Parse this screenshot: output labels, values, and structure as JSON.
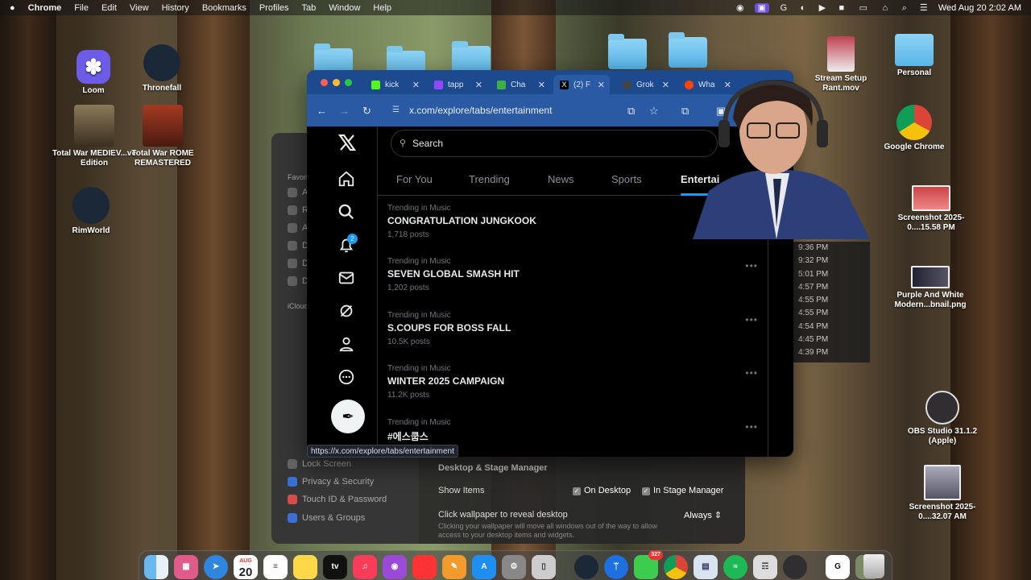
{
  "menubar": {
    "apple": "",
    "app": "Chrome",
    "items": [
      "File",
      "Edit",
      "View",
      "History",
      "Bookmarks",
      "Profiles",
      "Tab",
      "Window",
      "Help"
    ],
    "datetime": "Wed Aug 20  2:02 AM"
  },
  "desktop_icons": {
    "loom": "Loom",
    "thronefall": "Thronefall",
    "medieval": "Total War MEDIEV...ve Edition",
    "rome": "Total War ROME REMASTERED",
    "rimworld": "RimWorld",
    "stream": "Stream Setup Rant.mov",
    "personal": "Personal",
    "chrome": "Google Chrome",
    "shot1": "Screenshot 2025-0....15.58 PM",
    "purple": "Purple And White Modern...bnail.png",
    "obs": "OBS Studio 31.1.2 (Apple)",
    "shot2": "Screenshot 2025-0....32.07 AM"
  },
  "browser": {
    "tabs": [
      {
        "label": "kick",
        "color": "#53fc18"
      },
      {
        "label": "tapp",
        "color": "#9146ff"
      },
      {
        "label": "Cha",
        "color": "#3cb043"
      },
      {
        "label": "(2) F",
        "color": "#000000"
      },
      {
        "label": "Grok",
        "color": "#444444"
      },
      {
        "label": "Wha",
        "color": "#ff4500"
      }
    ],
    "url": "x.com/explore/tabs/entertainment",
    "status_url": "https://x.com/explore/tabs/entertainment"
  },
  "x": {
    "notif_count": "2",
    "search_placeholder": "Search",
    "tabs": [
      "For You",
      "Trending",
      "News",
      "Sports",
      "Entertai"
    ],
    "trends": [
      {
        "category": "Trending in Music",
        "title": "CONGRATULATION JUNGKOOK",
        "count": "1,718 posts"
      },
      {
        "category": "Trending in Music",
        "title": "SEVEN GLOBAL SMASH HIT",
        "count": "1,202 posts"
      },
      {
        "category": "Trending in Music",
        "title": "S.COUPS FOR BOSS FALL",
        "count": "10.5K posts"
      },
      {
        "category": "Trending in Music",
        "title": "WINTER 2025 CAMPAIGN",
        "count": "11.2K posts"
      },
      {
        "category": "Trending in Music",
        "title": "#에스쿱스",
        "count": ""
      }
    ]
  },
  "finder_times": [
    "9:36 PM",
    "9:32 PM",
    "5:01 PM",
    "4:57 PM",
    "4:55 PM",
    "4:55 PM",
    "4:54 PM",
    "4:45 PM",
    "4:39 PM"
  ],
  "settings": {
    "sidebar_top": [
      "Favori",
      "Ai",
      "Re",
      "Ap",
      "De",
      "Do",
      "Do"
    ],
    "icloud": "iCloud",
    "sidebar": [
      "Lock Screen",
      "Privacy & Security",
      "Touch ID & Password",
      "Users & Groups"
    ],
    "section": "Desktop & Stage Manager",
    "show_items": "Show Items",
    "on_desktop": "On Desktop",
    "in_stage": "In Stage Manager",
    "click_wallpaper": "Click wallpaper to reveal desktop",
    "always": "Always",
    "help": "Clicking your wallpaper will move all windows out of the way to allow access to your desktop items and widgets."
  },
  "dock": {
    "calendar_month": "AUG",
    "calendar_day": "20",
    "tv": "tv",
    "messages_badge": "327"
  }
}
